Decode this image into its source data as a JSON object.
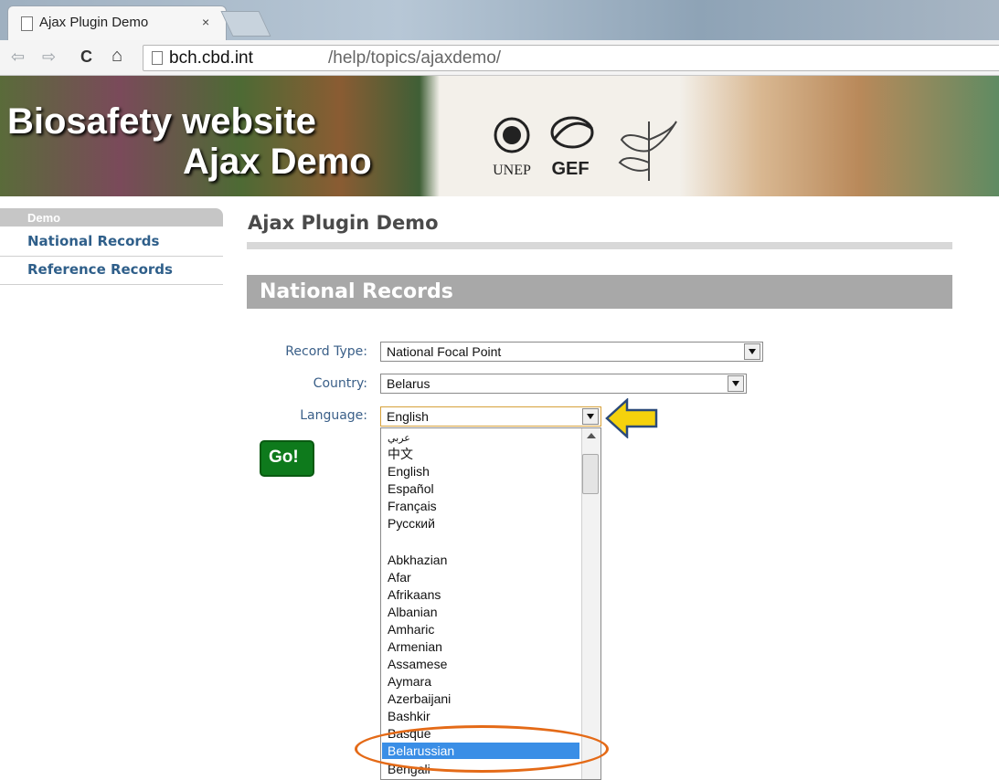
{
  "browser": {
    "tab_title": "Ajax Plugin Demo",
    "tab_close": "×",
    "url_host": "bch.cbd.int",
    "url_path": "/help/topics/ajaxdemo/",
    "nav": {
      "back": "⇦",
      "forward": "⇨",
      "reload": "C",
      "home": "⌂"
    }
  },
  "banner": {
    "title_line1": "Biosafety website",
    "title_line2": "Ajax Demo",
    "logo_unep": "UNEP",
    "logo_gef": "GEF"
  },
  "sidebar": {
    "heading": "Demo",
    "items": [
      {
        "label": "National Records"
      },
      {
        "label": "Reference Records"
      }
    ]
  },
  "main": {
    "page_title": "Ajax Plugin Demo",
    "section_title": "National Records",
    "form": {
      "record_type_label": "Record Type:",
      "record_type_value": "National Focal Point",
      "country_label": "Country:",
      "country_value": "Belarus",
      "language_label": "Language:",
      "language_value": "English",
      "go_label": "Go!"
    }
  },
  "language_dropdown": {
    "options": [
      "عربي",
      "中文",
      "English",
      "Español",
      "Français",
      "Русский",
      "",
      "Abkhazian",
      "Afar",
      "Afrikaans",
      "Albanian",
      "Amharic",
      "Armenian",
      "Assamese",
      "Aymara",
      "Azerbaijani",
      "Bashkir",
      "Basque"
    ],
    "selected": "Belarussian",
    "after_selected": "Bengali"
  },
  "annotations": {
    "arrow_color": "#f5d20c",
    "highlight_color": "#e46a17"
  }
}
